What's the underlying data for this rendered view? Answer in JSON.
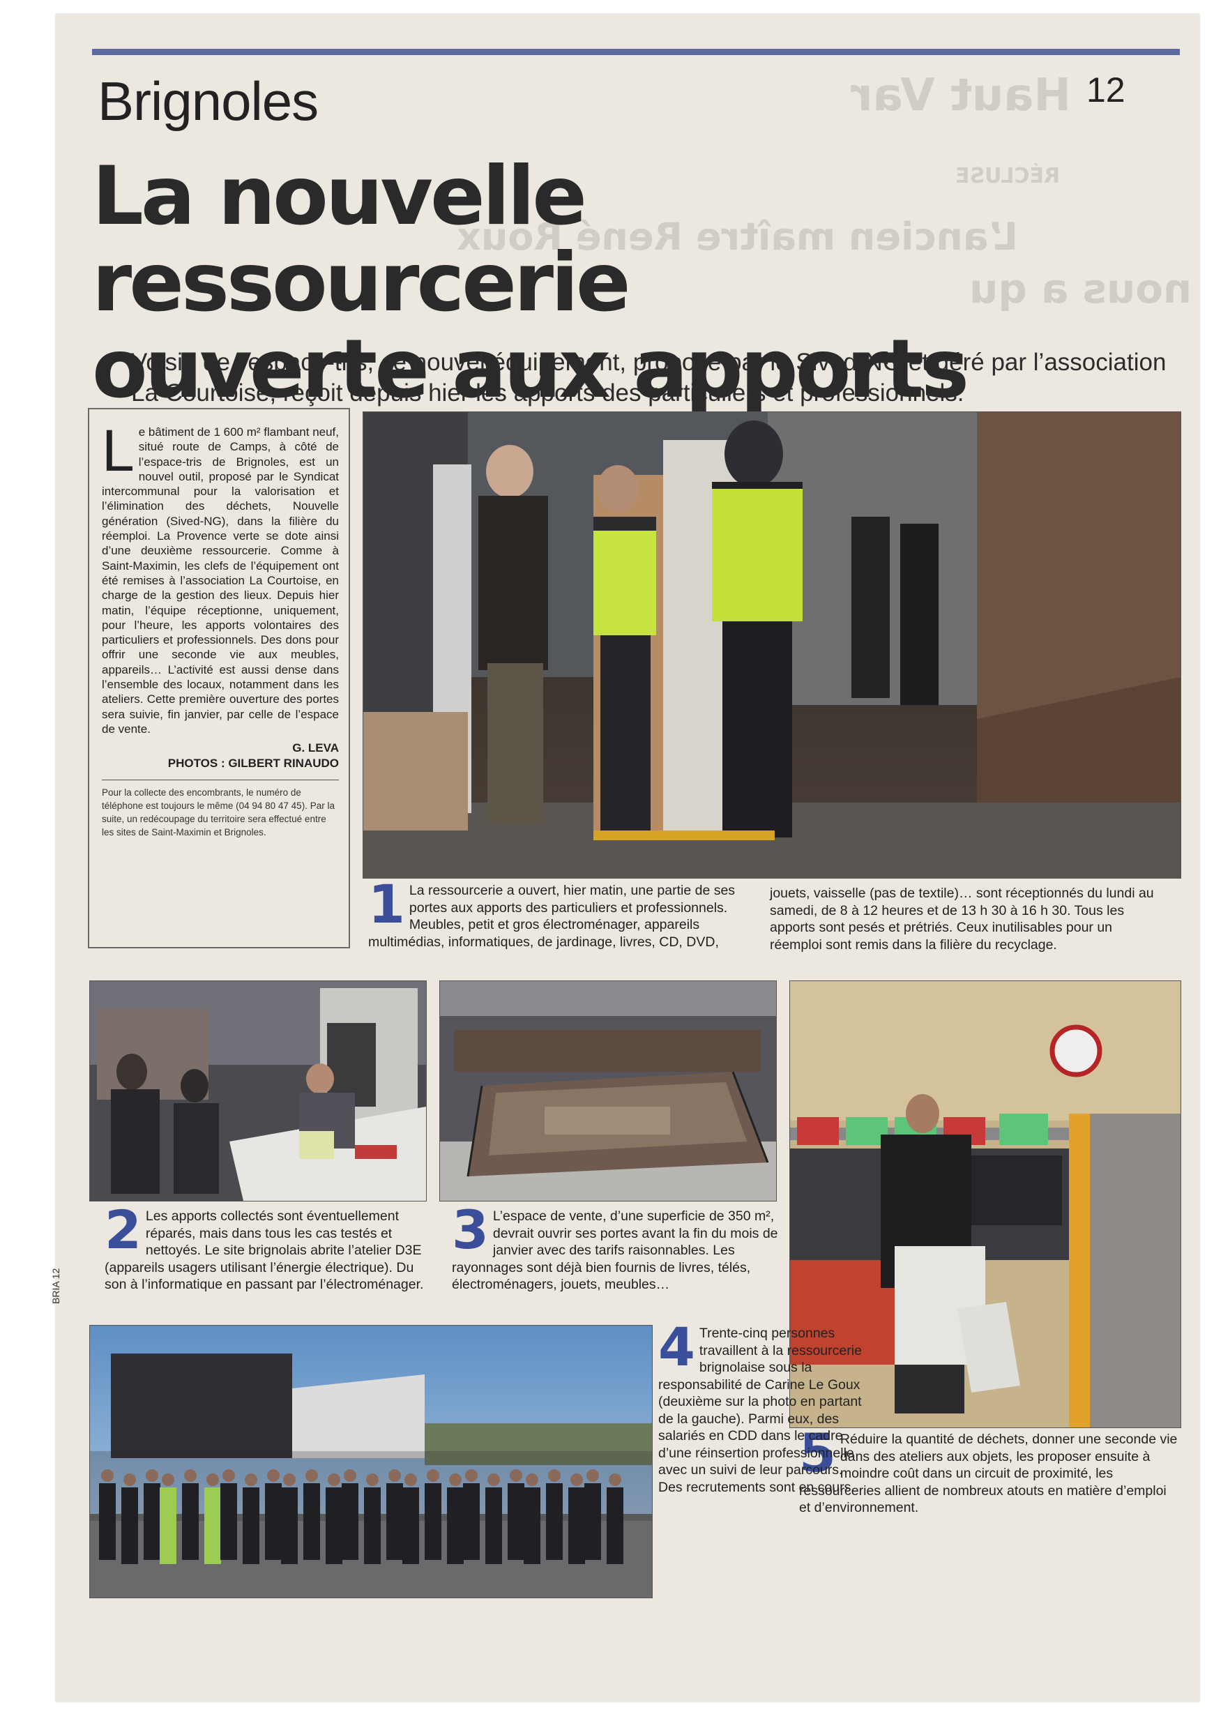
{
  "section": "Brignoles",
  "page_number": "12",
  "headline_lines": [
    "La nouvelle ressourcerie",
    "ouverte aux apports"
  ],
  "deck": "Voisin de l’espace-tris, ce nouvel équipement, proposé par le Sived-NG et géré par l’association La Courtoise, reçoit depuis hier les apports des particuliers et professionnels.",
  "bleed": {
    "haut_var": "Haut Var",
    "recluse": "RÉCLUSE",
    "ancien": "L’ancien maître René Roux",
    "nous": "nous a qu"
  },
  "article": {
    "dropcap": "L",
    "text": "e bâtiment de 1 600 m² flambant neuf, situé route de Camps, à côté de l’espace-tris de Brignoles, est un nouvel outil, proposé par le Syndicat intercommunal pour la valorisation et l’élimination des déchets, Nouvelle génération (Sived-NG), dans la filière du réemploi. La Provence verte se dote ainsi d’une deuxième ressourcerie. Comme à Saint-Maximin, les clefs de l’équipement ont été remises à l’association La Courtoise, en charge de la gestion des lieux. Depuis hier matin, l’équipe réceptionne, uniquement, pour l’heure, les apports volontaires des particuliers et professionnels. Des dons pour offrir une seconde vie aux meubles, appareils… L’activité est aussi dense dans l’ensemble des locaux, notamment dans les ateliers. Cette première ouverture des portes sera suivie, fin janvier, par celle de l’espace de vente.",
    "author": "G. LEVA",
    "photos": "PHOTOS : GILBERT RINAUDO",
    "note": "Pour la collecte des encombrants, le numéro de téléphone est toujours le même (04 94 80 47 45). Par la suite, un redécoupage du territoire sera effectué entre les sites de Saint-Maximin et Brignoles."
  },
  "captions": [
    {
      "num": "1",
      "text_a": "La ressourcerie a ouvert, hier matin, une partie de ses portes aux apports des particuliers et professionnels. Meubles, petit et gros électroménager, appareils multimédias, informatiques, de jardinage, livres, CD, DVD,",
      "text_b": "jouets, vaisselle (pas de textile)… sont réceptionnés du lundi au samedi, de 8 à 12 heures et de 13 h 30 à 16 h 30. Tous les apports sont pesés et prétriés. Ceux inutilisables pour un réemploi sont remis dans la filière du recyclage."
    },
    {
      "num": "2",
      "text": "Les apports collectés sont éventuellement réparés, mais dans tous les cas testés et nettoyés. Le site brignolais abrite l’atelier D3E (appareils usagers utilisant l’énergie électrique). Du son à l’informatique en passant par l’électroménager."
    },
    {
      "num": "3",
      "text": "L’espace de vente, d’une superficie de 350 m², devrait ouvrir ses portes avant la fin du mois de janvier avec des tarifs raisonnables. Les rayonnages sont déjà bien fournis de livres, télés, électroménagers, jouets, meubles…"
    },
    {
      "num": "4",
      "text": "Trente-cinq personnes travaillent à la ressourcerie brignolaise sous la responsabilité de Carine Le Goux (deuxième sur la photo en partant de la gauche). Parmi eux, des salariés en CDD dans le cadre d’une réinsertion professionnelle avec un suivi de leur parcours. Des recrutements sont en cours."
    },
    {
      "num": "5",
      "text": "Réduire la quantité de déchets, donner une seconde vie dans des ateliers aux objets, les proposer ensuite à moindre coût dans un circuit de proximité, les ressourceries allient de nombreux atouts en matière d’emploi et d’environnement."
    }
  ],
  "margin_code": "BRIA 12"
}
